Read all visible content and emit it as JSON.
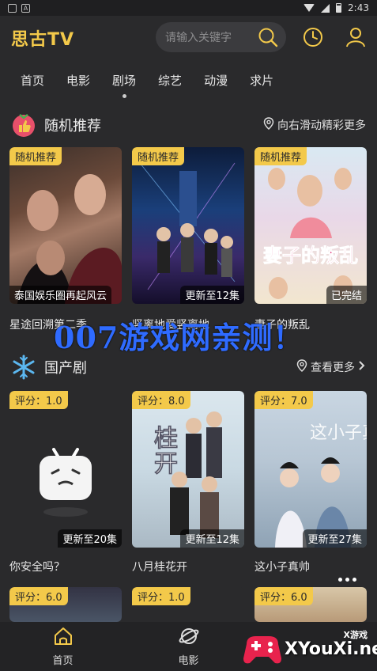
{
  "status_bar": {
    "time": "2:43",
    "app_badge": "A"
  },
  "header": {
    "title": "思古TV",
    "search_placeholder": "请输入关键字"
  },
  "nav": {
    "items": [
      "首页",
      "电影",
      "剧场",
      "综艺",
      "动漫",
      "求片"
    ],
    "active_index": 2
  },
  "section_random": {
    "title": "随机推荐",
    "more": "向右滑动精彩更多",
    "cards": [
      {
        "badge": "随机推荐",
        "caption": "泰国娱乐圈再起风云",
        "title": "星途回溯第二季",
        "caption_left": true
      },
      {
        "badge": "随机推荐",
        "caption": "更新至12集",
        "title": "竖离地爱竖离地",
        "caption_left": false
      },
      {
        "badge": "随机推荐",
        "caption": "已完结",
        "title": "妻子的叛乱",
        "caption_left": false
      }
    ]
  },
  "section_domestic": {
    "title": "国产剧",
    "more": "查看更多",
    "cards": [
      {
        "badge": "评分：1.0",
        "caption": "更新至20集",
        "title": "你安全吗？"
      },
      {
        "badge": "评分：8.0",
        "caption": "更新至12集",
        "title": "八月桂花开"
      },
      {
        "badge": "评分：7.0",
        "caption": "更新至27集",
        "title": "这小子真帅"
      }
    ],
    "row_next_badges": [
      "评分：6.0",
      "评分：1.0",
      "评分：6.0"
    ]
  },
  "watermark": "007游戏网亲测！",
  "bottom_nav": {
    "items": [
      "首页",
      "电影"
    ]
  },
  "overlay_logo": {
    "small": "X游戏",
    "big": "XYouXi.net"
  },
  "colors": {
    "accent": "#f3c94a",
    "background": "#2a2a2c"
  }
}
